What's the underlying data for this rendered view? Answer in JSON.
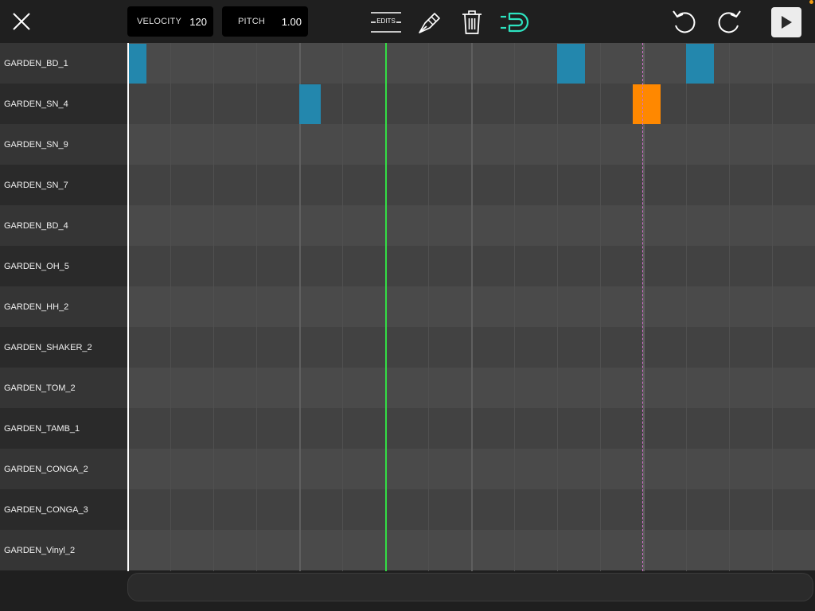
{
  "toolbar": {
    "close_icon": "close-icon",
    "velocity": {
      "label": "VELOCITY",
      "value": "120"
    },
    "pitch": {
      "label": "PITCH",
      "value": "1.00"
    },
    "edits_label": "EDITS",
    "draw_icon": "pen-icon",
    "delete_icon": "trash-icon",
    "snap_icon": "magnet-icon",
    "undo_icon": "undo-icon",
    "redo_icon": "redo-icon",
    "play_icon": "play-icon"
  },
  "colors": {
    "note_default": "#2387ad",
    "note_selected": "#ff8800",
    "playhead": "#33dd44",
    "loop_marker": "#d070c8",
    "snap_accent": "#2de3c0",
    "status_dot": "#f39c12"
  },
  "tracks": [
    "GARDEN_BD_1",
    "GARDEN_SN_4",
    "GARDEN_SN_9",
    "GARDEN_SN_7",
    "GARDEN_BD_4",
    "GARDEN_OH_5",
    "GARDEN_HH_2",
    "GARDEN_SHAKER_2",
    "GARDEN_TOM_2",
    "GARDEN_TAMB_1",
    "GARDEN_CONGA_2",
    "GARDEN_CONGA_3",
    "GARDEN_Vinyl_2"
  ],
  "notes": [
    {
      "track": 0,
      "step": 0,
      "length": 0.45,
      "selected": false
    },
    {
      "track": 1,
      "step": 4,
      "length": 0.5,
      "selected": false
    },
    {
      "track": 0,
      "step": 10,
      "length": 0.65,
      "selected": false
    },
    {
      "track": 1,
      "step": 11.75,
      "length": 0.65,
      "selected": true
    },
    {
      "track": 0,
      "step": 13,
      "length": 0.65,
      "selected": false
    }
  ]
}
